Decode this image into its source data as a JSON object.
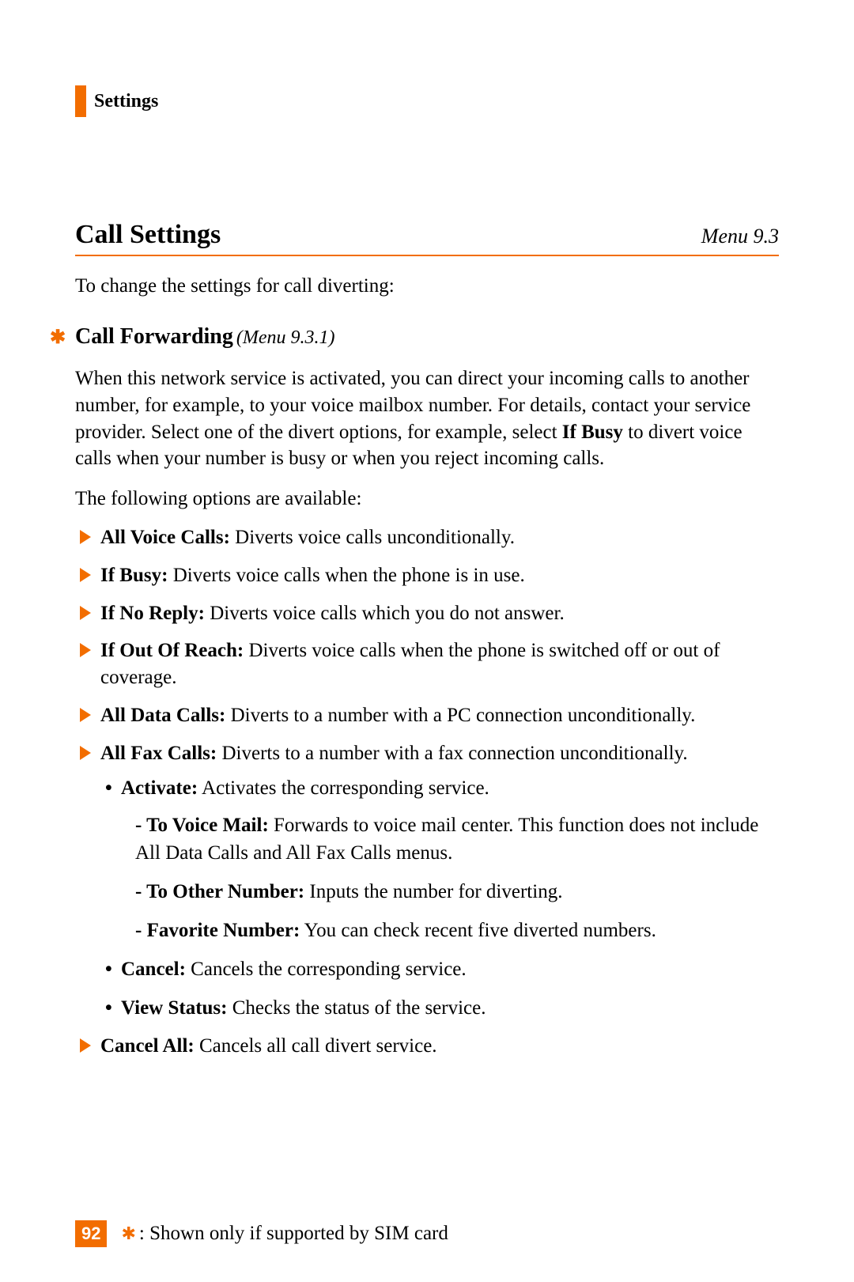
{
  "header": {
    "title": "Settings"
  },
  "section": {
    "title": "Call Settings",
    "menu": "Menu 9.3"
  },
  "intro": "To change the settings for call diverting:",
  "subsection": {
    "title": "Call Forwarding",
    "menu": "(Menu 9.3.1)"
  },
  "para": "When this network service is activated, you can direct your incoming calls to another number, for example, to your voice mailbox number. For details, contact your service provider. Select one of the divert options, for example, select ",
  "para_bold": "If Busy",
  "para_tail": " to divert voice calls when your number is busy or when you reject incoming calls.",
  "options_intro": "The following options are available:",
  "options": [
    {
      "label": "All Voice Calls:",
      "desc": " Diverts voice calls unconditionally."
    },
    {
      "label": "If Busy:",
      "desc": " Diverts voice calls when the phone is in use."
    },
    {
      "label": "If No Reply:",
      "desc": " Diverts voice calls which you do not answer."
    },
    {
      "label": "If Out Of Reach:",
      "desc": " Diverts voice calls when the phone is switched off or out of coverage."
    },
    {
      "label": "All Data Calls:",
      "desc": " Diverts to a number with a PC connection unconditionally."
    },
    {
      "label": "All Fax Calls:",
      "desc": " Diverts to a number with a fax connection unconditionally."
    }
  ],
  "bullets": [
    {
      "label": "Activate:",
      "desc": " Activates the corresponding service."
    }
  ],
  "dashes": [
    {
      "label": "To Voice Mail:",
      "desc": " Forwards to voice mail center. This function does not include All Data Calls and All Fax Calls menus."
    },
    {
      "label": "To Other Number:",
      "desc": " Inputs the number for diverting."
    },
    {
      "label": "Favorite Number:",
      "desc": " You can check recent five diverted numbers."
    }
  ],
  "bullets2": [
    {
      "label": "Cancel:",
      "desc": " Cancels the corresponding service."
    },
    {
      "label": "View Status:",
      "desc": " Checks the status of the service."
    }
  ],
  "cancel_all": {
    "label": "Cancel All:",
    "desc": " Cancels all call divert service."
  },
  "footer": {
    "page": "92",
    "note": ": Shown only if supported by SIM card"
  }
}
